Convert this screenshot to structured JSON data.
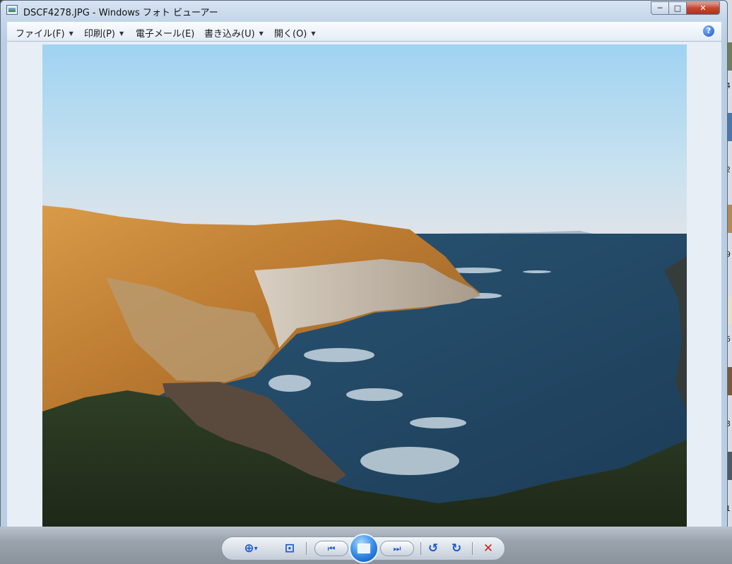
{
  "window": {
    "title": "DSCF4278.JPG - Windows フォト ビューアー",
    "buttons": {
      "minimize": "─",
      "maximize": "□",
      "close": "✕"
    }
  },
  "menu": {
    "items": [
      {
        "label": "ファイル(F)",
        "has_dropdown": true
      },
      {
        "label": "印刷(P)",
        "has_dropdown": true
      },
      {
        "label": "電子メール(E)",
        "has_dropdown": false
      },
      {
        "label": "書き込み(U)",
        "has_dropdown": true
      },
      {
        "label": "開く(O)",
        "has_dropdown": true
      }
    ],
    "help_label": "?"
  },
  "photo": {
    "subject": "seaside cliffs at sunset with blue ocean",
    "colors": {
      "sky_top": "#a8d7f2",
      "sky_bottom": "#e4e6ea",
      "sea": "#23455f",
      "cliff": "#c9883d"
    }
  },
  "controls": {
    "icons": [
      "zoom-icon",
      "actual-size-icon",
      "previous-icon",
      "slideshow-icon",
      "next-icon",
      "rotate-counterclockwise-icon",
      "rotate-clockwise-icon",
      "delete-icon"
    ],
    "glyphs": {
      "zoom": "⊕",
      "zoom_arrow": "▾",
      "fit": "⊡",
      "prev": "⏮",
      "next": "⏭",
      "rotate_ccw": "↺",
      "rotate_cw": "↻",
      "delete": "✕"
    }
  },
  "desktop": {
    "right_edge_numbers": [
      "4",
      "2",
      "9",
      "6",
      "3",
      "1"
    ]
  }
}
